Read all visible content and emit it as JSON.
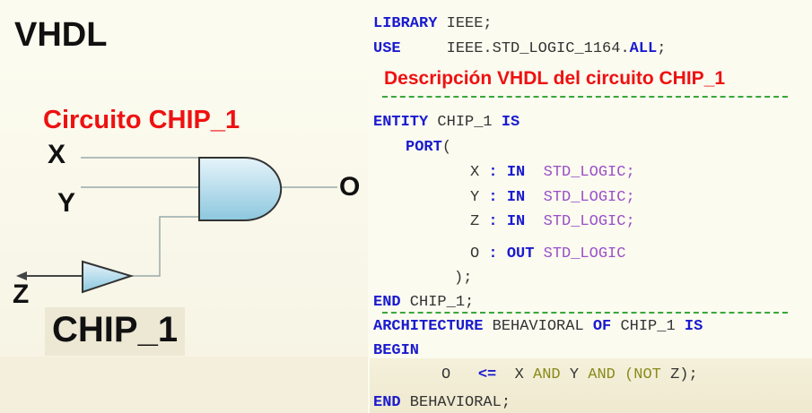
{
  "left": {
    "title": "VHDL",
    "circuit_title": "Circuito CHIP_1",
    "chip_name": "CHIP_1",
    "signals": {
      "x": "X",
      "y": "Y",
      "z": "Z",
      "o": "O"
    }
  },
  "code": {
    "l1_kw": "LIBRARY",
    "l1_rest": " IEEE;",
    "l2_kw": "USE",
    "l2_mid": "     IEEE.STD_LOGIC_1164.",
    "l2_all": "ALL",
    "l2_end": ";",
    "description": "Descripción VHDL del circuito CHIP_1",
    "entity_kw": "ENTITY",
    "entity_name": " CHIP_1 ",
    "is_kw": "IS",
    "port_kw": "PORT",
    "port_paren": "(",
    "x_name": "X",
    "y_name": "Y",
    "z_name": "Z",
    "o_name": "O",
    "colon": " : ",
    "in_kw": "IN",
    "out_kw": "OUT",
    "std_logic_semi": "STD_LOGIC;",
    "std_logic": "STD_LOGIC",
    "close_paren": ");",
    "end_kw": "END",
    "end_chip": " CHIP_1;",
    "arch_kw": "ARCHITECTURE",
    "arch_name": " BEHAVIORAL ",
    "of_kw": "OF",
    "arch_chip": " CHIP_1 ",
    "begin_kw": "BEGIN",
    "assign_o": "O",
    "assign_op": "<=",
    "assign_x": "X",
    "and1": "AND",
    "assign_y": "Y",
    "and2": "AND",
    "open_p": "(",
    "not_kw": "NOT",
    "assign_z": " Z",
    "assign_end": ");",
    "end_behav": " BEHAVIORAL;"
  }
}
